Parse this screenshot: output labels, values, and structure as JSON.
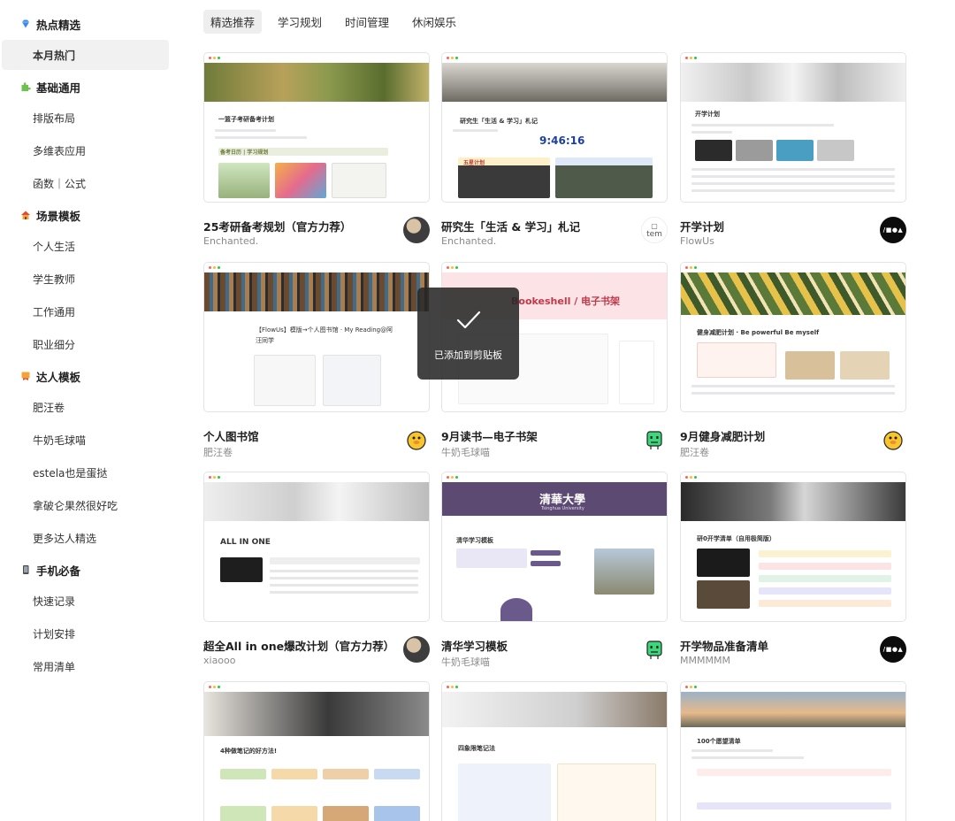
{
  "sidebar": {
    "groups": [
      {
        "icon": "diamond-icon",
        "label": "热点精选",
        "items": [
          "本月热门"
        ]
      },
      {
        "icon": "puzzle-icon",
        "label": "基础通用",
        "items": [
          "排版布局",
          "多维表应用",
          "函数｜公式"
        ]
      },
      {
        "icon": "house-icon",
        "label": "场景模板",
        "items": [
          "个人生活",
          "学生教师",
          "工作通用",
          "职业细分"
        ]
      },
      {
        "icon": "ribbon-icon",
        "label": "达人模板",
        "items": [
          "肥汪卷",
          "牛奶毛球喵",
          "estela也是蛋挞",
          "拿破仑果然很好吃",
          "更多达人精选"
        ]
      },
      {
        "icon": "phone-icon",
        "label": "手机必备",
        "items": [
          "快速记录",
          "计划安排",
          "常用清单"
        ]
      }
    ],
    "active_item": "本月热门"
  },
  "tabs": [
    "精选推荐",
    "学习规划",
    "时间管理",
    "休闲娱乐"
  ],
  "active_tab": "精选推荐",
  "cards": [
    {
      "title": "25考研备考规划（官方力荐）",
      "author": "Enchanted.",
      "avatar": "photo-avatar",
      "thumb": {
        "heading": "一篮子考研备考计划",
        "section": "备考日历 | 学习规划"
      }
    },
    {
      "title": "研究生「生活 & 学习」札记",
      "author": "Enchanted.",
      "avatar": "broken-image-avatar",
      "avatar_text": "tem",
      "thumb": {
        "heading": "研究生「生活 & 学习」札记",
        "clock": "9:46:16",
        "section": "五星计划"
      }
    },
    {
      "title": "开学计划",
      "author": "FlowUs",
      "avatar": "flowus-logo-avatar",
      "avatar_text": "/■●▲",
      "thumb": {
        "heading": "开学计划"
      }
    },
    {
      "title": "个人图书馆",
      "author": "肥汪卷",
      "avatar": "duck-avatar",
      "thumb": {
        "heading": "【FlowUs】模版→个人图书馆 · My Reading@阿汪同学"
      }
    },
    {
      "title": "9月读书—电子书架",
      "author": "牛奶毛球喵",
      "avatar": "green-robot-avatar",
      "thumb": {
        "heading": "Bookeshell / 电子书架"
      }
    },
    {
      "title": "9月健身减肥计划",
      "author": "肥汪卷",
      "avatar": "duck-avatar",
      "thumb": {
        "heading": "健身减肥计划 · Be powerful Be myself"
      }
    },
    {
      "title": "超全All in one爆改计划（官方力荐）",
      "author": "xiaooo",
      "avatar": "photo-avatar",
      "thumb": {
        "heading": "ALL IN ONE"
      }
    },
    {
      "title": "清华学习模板",
      "author": "牛奶毛球喵",
      "avatar": "green-robot-avatar",
      "thumb": {
        "heading": "清华学习模板",
        "banner": "清華大學",
        "banner_sub": "Tsinghua University"
      }
    },
    {
      "title": "开学物品准备清单",
      "author": "MMMMMM",
      "avatar": "flowus-logo-avatar",
      "avatar_text": "/■●▲",
      "thumb": {
        "heading": "研0开学清单（自用极简版）"
      }
    },
    {
      "title": "",
      "author": "",
      "avatar": "",
      "thumb": {
        "heading": "4种做笔记的好方法!"
      }
    },
    {
      "title": "",
      "author": "",
      "avatar": "",
      "thumb": {
        "heading": "四象限笔记法"
      }
    },
    {
      "title": "",
      "author": "",
      "avatar": "",
      "thumb": {
        "heading": "100个愿望清单"
      }
    }
  ],
  "toast": {
    "message": "已添加到剪贴板",
    "icon": "check-icon"
  },
  "colors": {
    "accent_gray": "#f1f1f2",
    "toast_bg": "#282828"
  }
}
